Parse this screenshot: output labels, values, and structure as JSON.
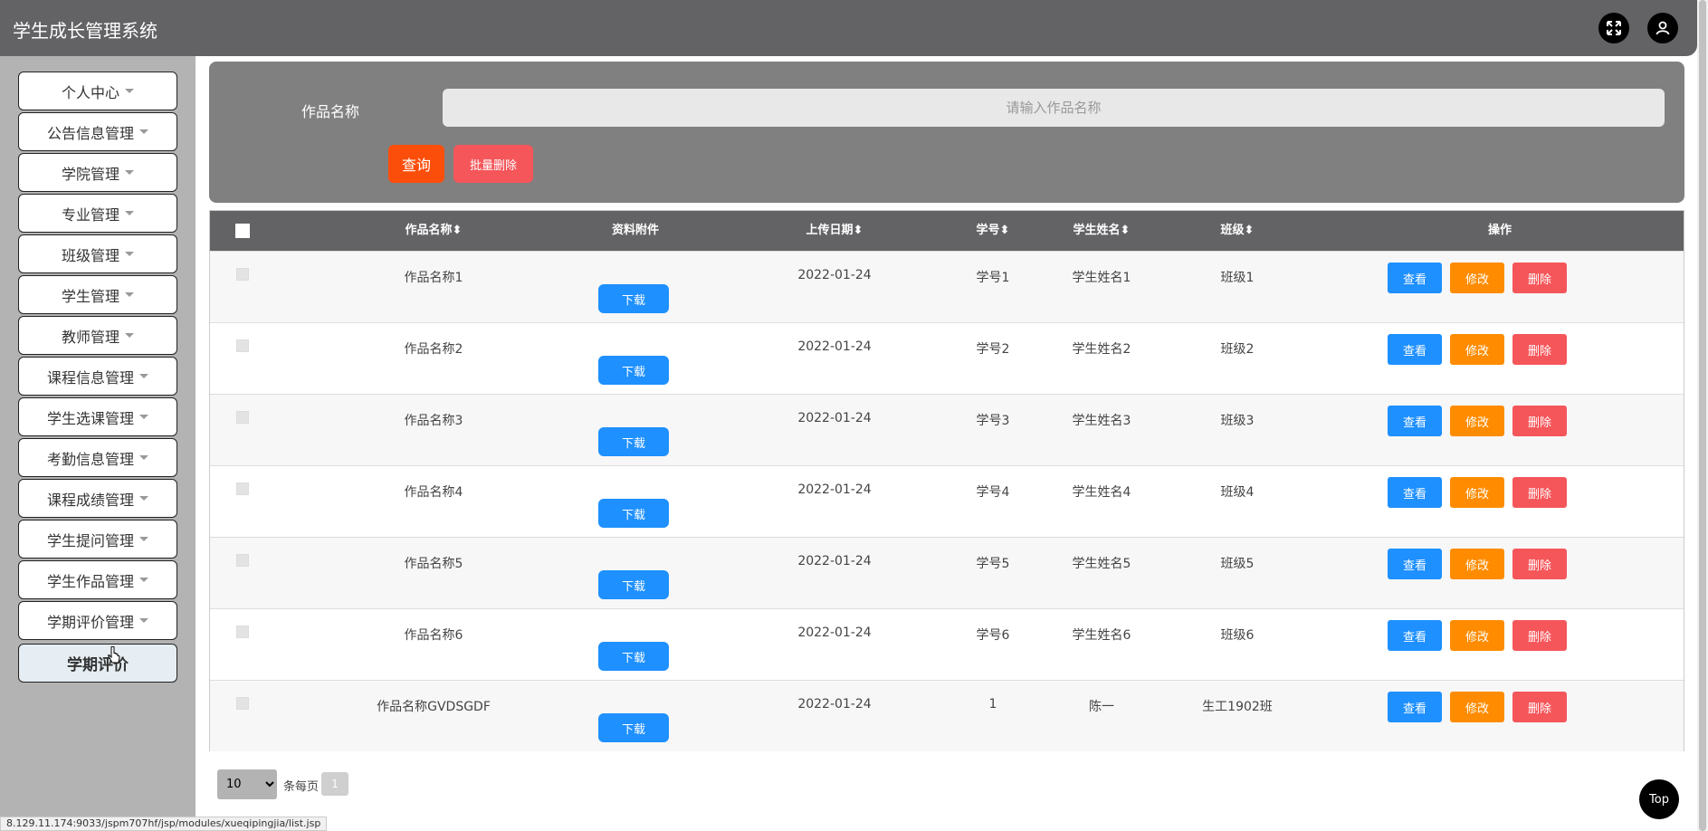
{
  "app": {
    "title": "学生成长管理系统"
  },
  "header": {
    "fullscreen_icon": "expand-icon",
    "user_icon": "user-icon"
  },
  "sidebar": {
    "items": [
      {
        "label": "个人中心"
      },
      {
        "label": "公告信息管理"
      },
      {
        "label": "学院管理"
      },
      {
        "label": "专业管理"
      },
      {
        "label": "班级管理"
      },
      {
        "label": "学生管理"
      },
      {
        "label": "教师管理"
      },
      {
        "label": "课程信息管理"
      },
      {
        "label": "学生选课管理"
      },
      {
        "label": "考勤信息管理"
      },
      {
        "label": "课程成绩管理"
      },
      {
        "label": "学生提问管理"
      },
      {
        "label": "学生作品管理"
      },
      {
        "label": "学期评价管理"
      }
    ],
    "active_sub": "学期评价"
  },
  "search": {
    "label": "作品名称",
    "placeholder": "请输入作品名称",
    "query_button": "查询",
    "batch_delete_button": "批量删除"
  },
  "table": {
    "columns": {
      "name": "作品名称",
      "attachment": "资料附件",
      "date": "上传日期",
      "student_no": "学号",
      "student_name": "学生姓名",
      "class": "班级",
      "actions": "操作"
    },
    "download_label": "下载",
    "view_label": "查看",
    "edit_label": "修改",
    "delete_label": "删除",
    "rows": [
      {
        "name": "作品名称1",
        "date": "2022-01-24",
        "student_no": "学号1",
        "student_name": "学生姓名1",
        "class": "班级1"
      },
      {
        "name": "作品名称2",
        "date": "2022-01-24",
        "student_no": "学号2",
        "student_name": "学生姓名2",
        "class": "班级2"
      },
      {
        "name": "作品名称3",
        "date": "2022-01-24",
        "student_no": "学号3",
        "student_name": "学生姓名3",
        "class": "班级3"
      },
      {
        "name": "作品名称4",
        "date": "2022-01-24",
        "student_no": "学号4",
        "student_name": "学生姓名4",
        "class": "班级4"
      },
      {
        "name": "作品名称5",
        "date": "2022-01-24",
        "student_no": "学号5",
        "student_name": "学生姓名5",
        "class": "班级5"
      },
      {
        "name": "作品名称6",
        "date": "2022-01-24",
        "student_no": "学号6",
        "student_name": "学生姓名6",
        "class": "班级6"
      },
      {
        "name": "作品名称GVDSGDF",
        "date": "2022-01-24",
        "student_no": "1",
        "student_name": "陈一",
        "class": "生工1902班"
      }
    ]
  },
  "pagination": {
    "page_size": "10",
    "per_page_label": "条每页",
    "current_page": "1"
  },
  "top_button": "Top",
  "status_url": "8.129.11.174:9033/jspm707hf/jsp/modules/xueqipingjia/list.jsp",
  "colors": {
    "header": "#636366",
    "sidebar": "#b3b3b3",
    "query": "#fc4e0b",
    "delete": "#f5565a",
    "view": "#1e90ff",
    "edit": "#ff8c00"
  }
}
